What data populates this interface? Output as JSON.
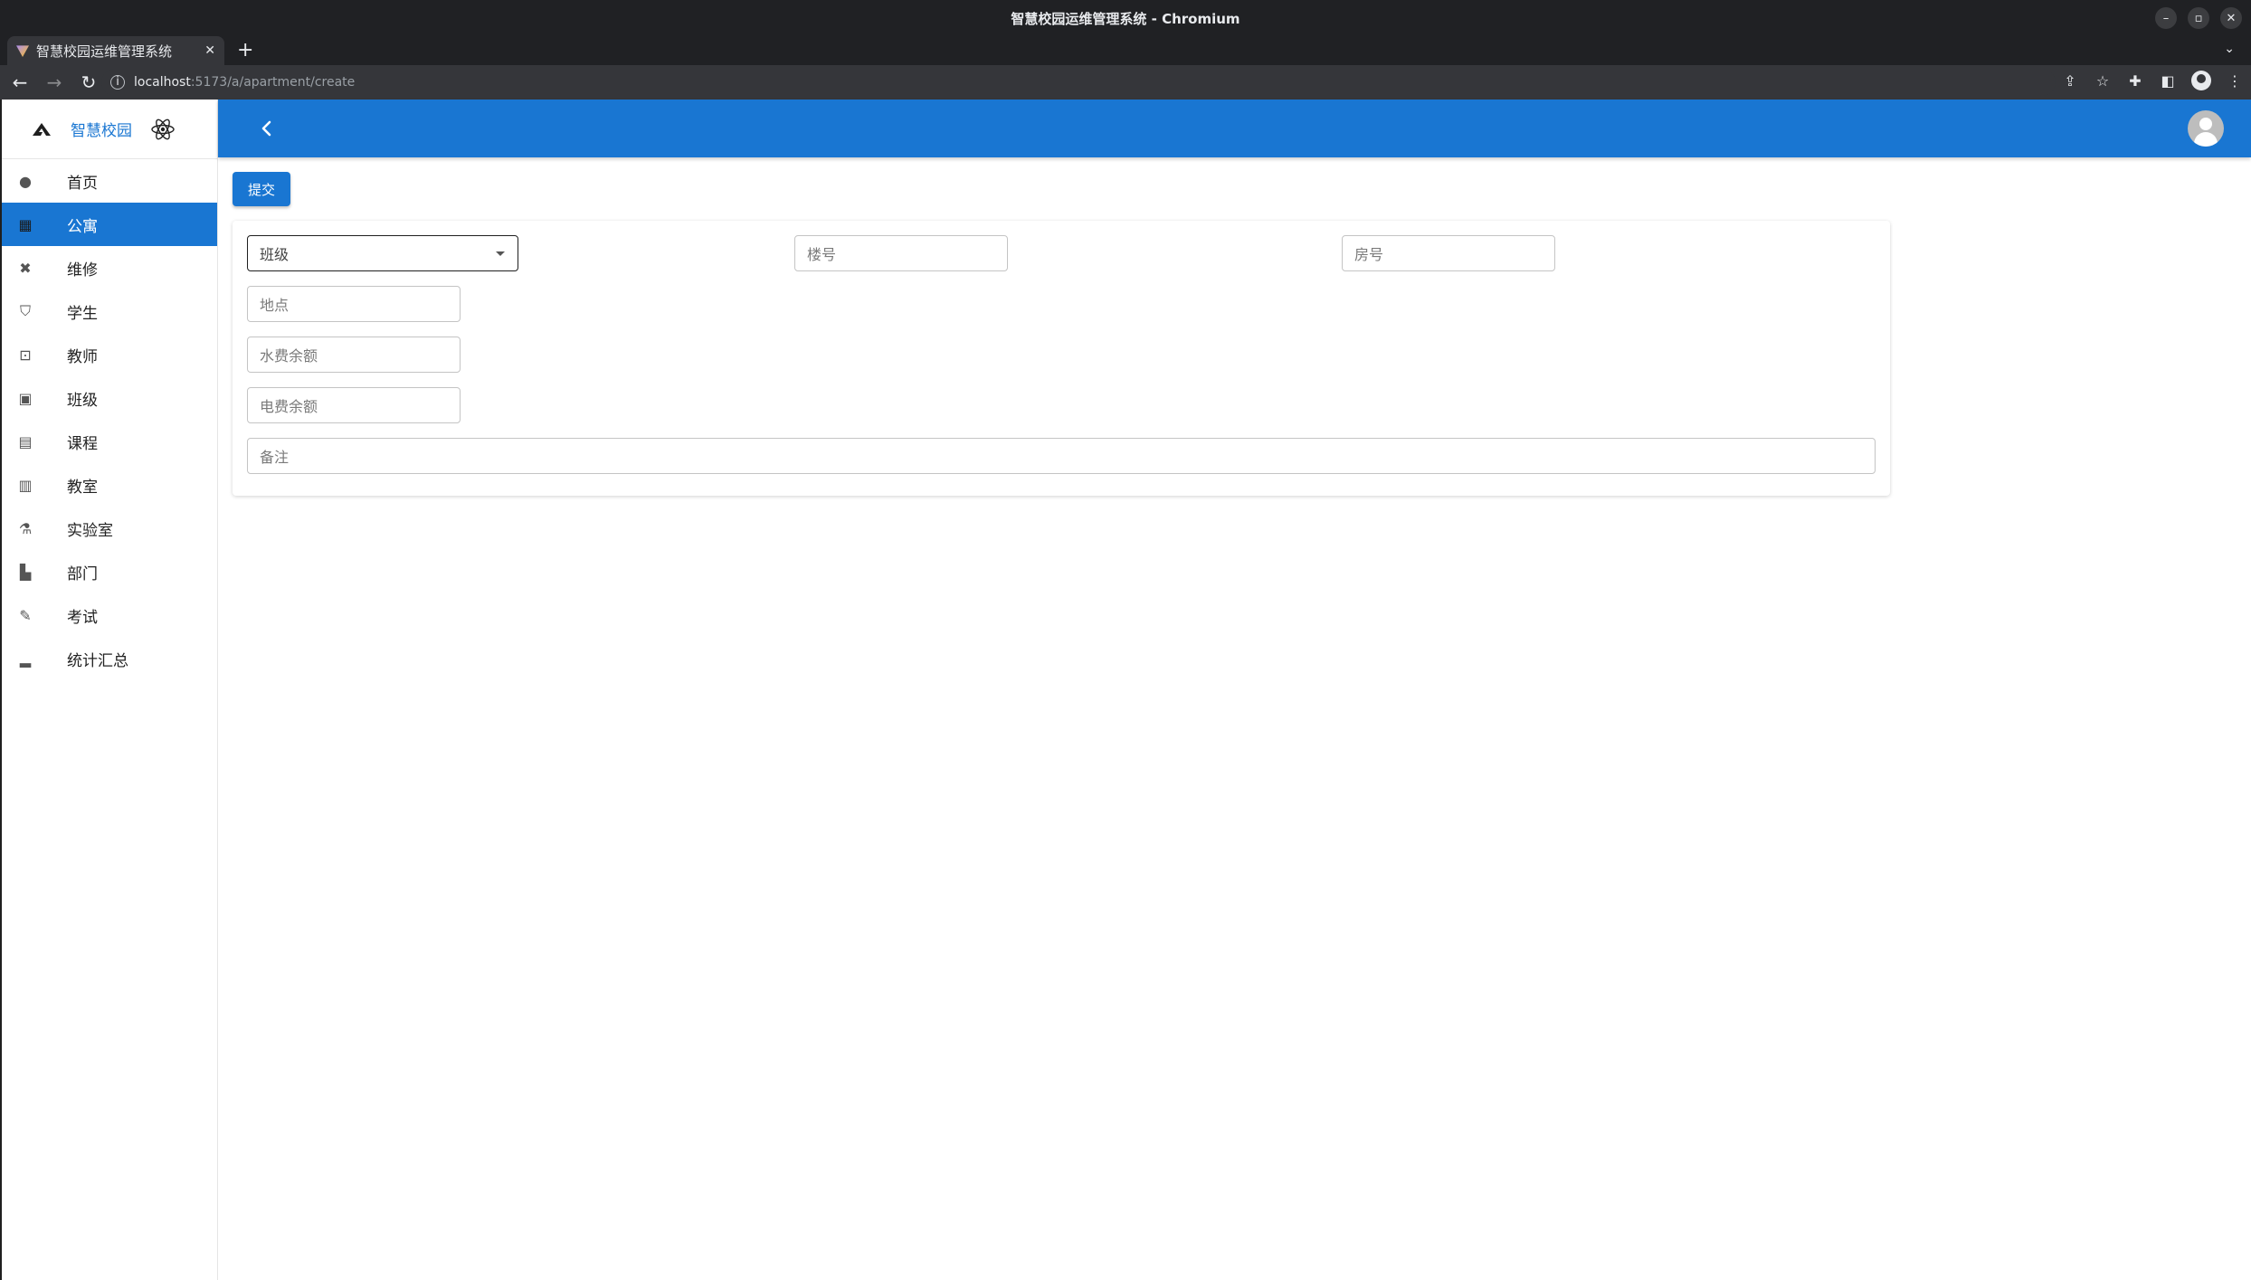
{
  "window": {
    "title": "智慧校园运维管理系统 - Chromium",
    "controls": [
      "–",
      "▫",
      "✕"
    ]
  },
  "browser": {
    "tab_title": "智慧校园运维管理系统",
    "tab_close": "✕",
    "new_tab": "+",
    "tab_list": "⌄",
    "back": "←",
    "forward": "→",
    "reload": "↻",
    "url_host": "localhost",
    "url_path": ":5173/a/apartment/create",
    "icons": [
      "share-icon",
      "star-icon",
      "extensions-icon",
      "side-panel-icon",
      "profile-icon",
      "menu-icon"
    ]
  },
  "sidebar": {
    "brand_name": "智慧校园",
    "items": [
      {
        "label": "首页",
        "icon": "dashboard-icon",
        "glyph": "●",
        "active": false
      },
      {
        "label": "公寓",
        "icon": "apartment-icon",
        "glyph": "▦",
        "active": true
      },
      {
        "label": "维修",
        "icon": "tools-icon",
        "glyph": "✖",
        "active": false
      },
      {
        "label": "学生",
        "icon": "student-icon",
        "glyph": "⛉",
        "active": false
      },
      {
        "label": "教师",
        "icon": "teacher-icon",
        "glyph": "⊡",
        "active": false
      },
      {
        "label": "班级",
        "icon": "class-icon",
        "glyph": "▣",
        "active": false
      },
      {
        "label": "课程",
        "icon": "course-table-icon",
        "glyph": "▤",
        "active": false
      },
      {
        "label": "教室",
        "icon": "classroom-building-icon",
        "glyph": "▥",
        "active": false
      },
      {
        "label": "实验室",
        "icon": "lab-flask-icon",
        "glyph": "⚗",
        "active": false
      },
      {
        "label": "部门",
        "icon": "department-icon",
        "glyph": "▙",
        "active": false
      },
      {
        "label": "考试",
        "icon": "exam-pen-icon",
        "glyph": "✎",
        "active": false
      },
      {
        "label": "统计汇总",
        "icon": "statistics-icon",
        "glyph": "▂",
        "active": false
      }
    ]
  },
  "topbar": {
    "back_icon": "chevron-left-icon",
    "avatar_icon": "user-avatar-icon"
  },
  "form": {
    "submit_label": "提交",
    "class_select_placeholder": "班级",
    "building_placeholder": "楼号",
    "room_placeholder": "房号",
    "location_placeholder": "地点",
    "water_balance_placeholder": "水费余额",
    "electric_balance_placeholder": "电费余额",
    "remark_placeholder": "备注"
  },
  "colors": {
    "primary": "#1976d2",
    "chrome_dark": "#202124",
    "chrome_toolbar": "#35363a"
  }
}
